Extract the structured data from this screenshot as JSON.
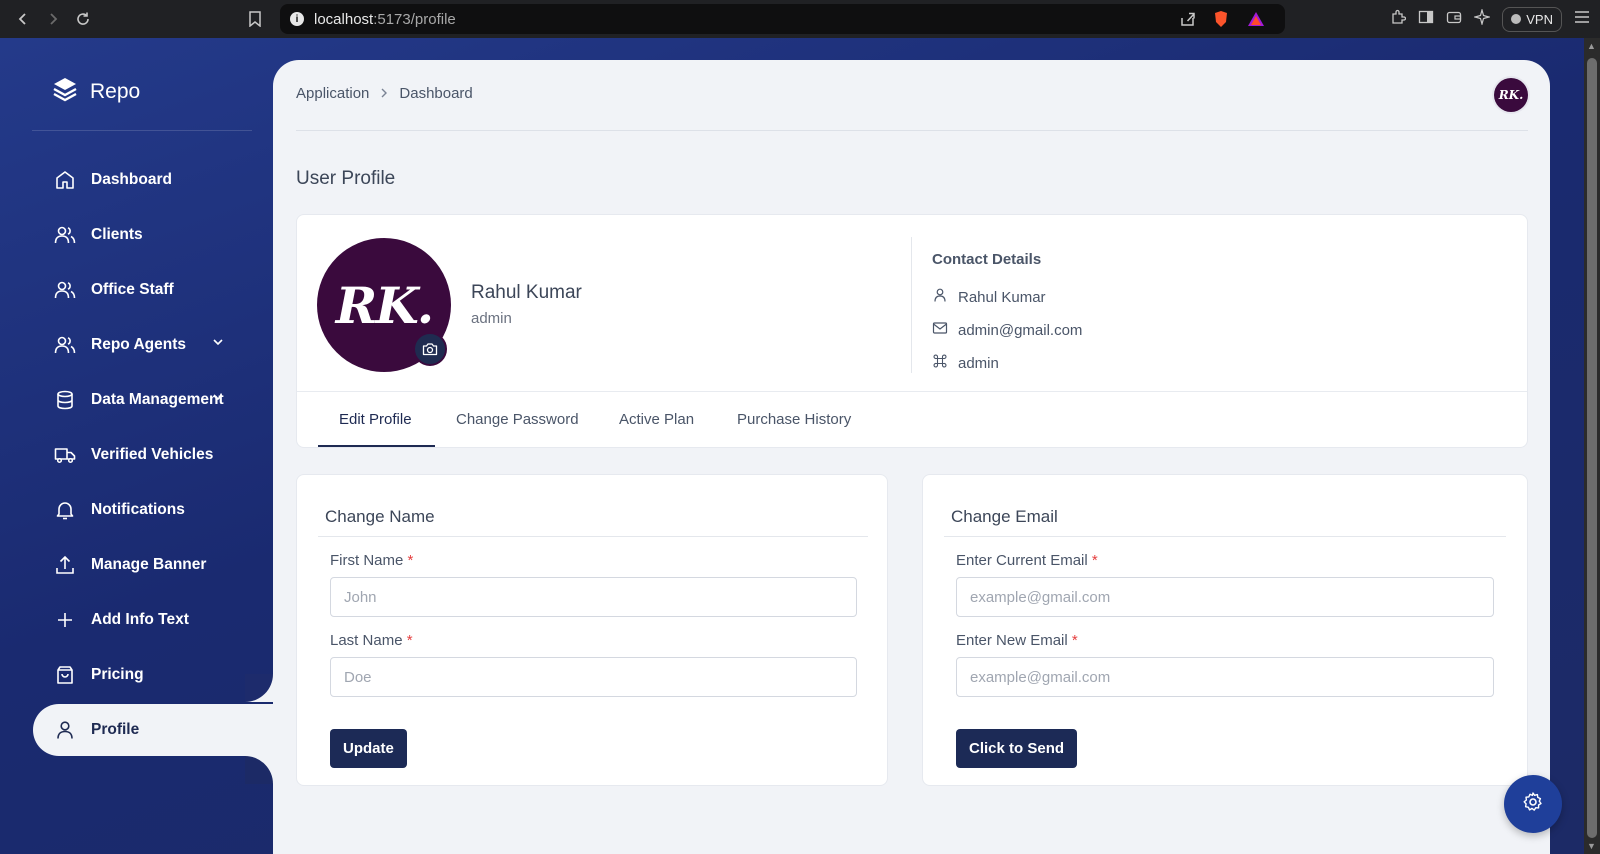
{
  "browser": {
    "url_host": "localhost",
    "url_path": ":5173/profile",
    "vpn_label": "VPN"
  },
  "sidebar": {
    "brand": "Repo",
    "items": [
      {
        "label": "Dashboard",
        "icon": "home-icon"
      },
      {
        "label": "Clients",
        "icon": "users-icon"
      },
      {
        "label": "Office Staff",
        "icon": "users-icon"
      },
      {
        "label": "Repo Agents",
        "icon": "users-icon",
        "expandable": true
      },
      {
        "label": "Data Management",
        "icon": "database-icon",
        "expandable": true
      },
      {
        "label": "Verified Vehicles",
        "icon": "truck-icon"
      },
      {
        "label": "Notifications",
        "icon": "bell-icon"
      },
      {
        "label": "Manage Banner",
        "icon": "upload-icon"
      },
      {
        "label": "Add Info Text",
        "icon": "plus-icon"
      },
      {
        "label": "Pricing",
        "icon": "shopping-bag-icon"
      },
      {
        "label": "Profile",
        "icon": "user-icon",
        "active": true
      }
    ]
  },
  "header": {
    "breadcrumb": [
      "Application",
      "Dashboard"
    ],
    "avatar_text": "RK."
  },
  "page": {
    "title": "User Profile"
  },
  "profile": {
    "avatar_text": "RK.",
    "name": "Rahul Kumar",
    "role": "admin",
    "contact_title": "Contact Details",
    "contact_name": "Rahul Kumar",
    "contact_email": "admin@gmail.com",
    "contact_role": "admin"
  },
  "tabs": [
    {
      "label": "Edit Profile",
      "active": true
    },
    {
      "label": "Change Password"
    },
    {
      "label": "Active Plan"
    },
    {
      "label": "Purchase History"
    }
  ],
  "change_name": {
    "title": "Change Name",
    "first_label": "First Name",
    "first_placeholder": "John",
    "last_label": "Last Name",
    "last_placeholder": "Doe",
    "button": "Update"
  },
  "change_email": {
    "title": "Change Email",
    "current_label": "Enter Current Email",
    "current_placeholder": "example@gmail.com",
    "new_label": "Enter New Email",
    "new_placeholder": "example@gmail.com",
    "button": "Click to Send"
  },
  "required_marker": "*",
  "colors": {
    "sidebar_bg": "#1d2b6c",
    "primary_button": "#1c2a56",
    "avatar_bg": "#3a0a3d",
    "required": "#e53e3e",
    "fab": "#1f3f9a"
  }
}
